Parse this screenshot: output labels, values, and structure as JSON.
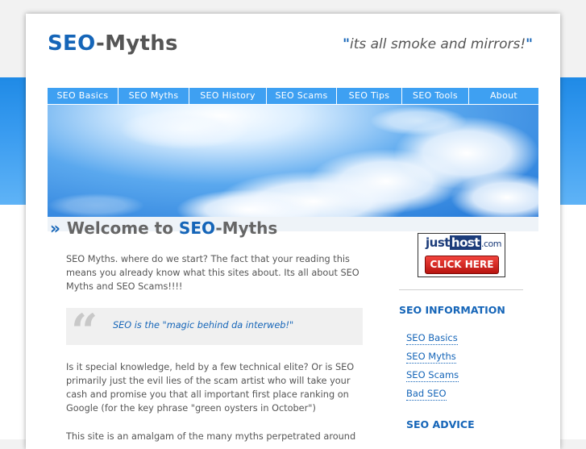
{
  "header": {
    "logo_part1": "SEO",
    "logo_part2": "-Myths",
    "tagline_open": "\"",
    "tagline": "its all smoke and mirrors!",
    "tagline_close": "\""
  },
  "nav": {
    "items": [
      {
        "label": "SEO Basics"
      },
      {
        "label": "SEO Myths"
      },
      {
        "label": "SEO History"
      },
      {
        "label": "SEO Scams"
      },
      {
        "label": "SEO Tips"
      },
      {
        "label": "SEO Tools"
      },
      {
        "label": "About"
      }
    ]
  },
  "main": {
    "welcome_arrow": "»",
    "welcome_prefix": "Welcome to ",
    "welcome_brand": "SEO",
    "welcome_suffix": "-Myths",
    "intro": "SEO Myths. where do we start? The fact that your reading this means you already know what this sites about. Its all about SEO Myths and SEO Scams!!!!",
    "quote_mark": "“",
    "quote": "SEO is the \"magic behind da interweb!\"",
    "para2": "Is it special knowledge, held by a few technical elite? Or is SEO primarily just the evil lies of the scam artist who will take your cash and promise you that all important first place ranking on Google (for the key phrase \"green oysters in October\")",
    "para3": "This site is an amalgam of the many myths perpetrated around"
  },
  "sidebar": {
    "ad": {
      "logo_a": "just",
      "logo_b": "host",
      "logo_c": ".com",
      "button": "CLICK HERE"
    },
    "info_heading": "SEO INFORMATION",
    "info_links": [
      {
        "label": "SEO Basics"
      },
      {
        "label": "SEO Myths"
      },
      {
        "label": "SEO Scams"
      },
      {
        "label": "Bad SEO"
      }
    ],
    "advice_heading": "SEO ADVICE"
  },
  "colors": {
    "brand_blue": "#1565b8",
    "nav_blue": "#3ea0f2",
    "band_blue": "#1f8ae6"
  }
}
